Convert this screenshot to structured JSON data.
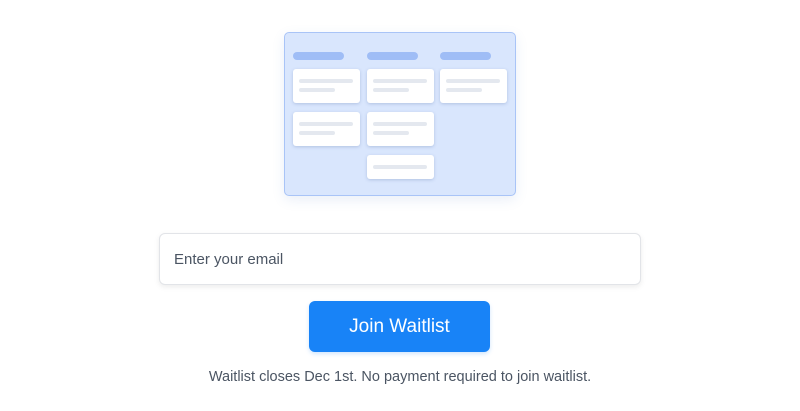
{
  "waitlist": {
    "email_placeholder": "Enter your email",
    "join_button_label": "Join Waitlist",
    "note": "Waitlist closes Dec 1st. No payment required to join waitlist."
  },
  "theme": {
    "accent": "#1883f7",
    "illustration_bg": "#d9e6fd",
    "illustration_header": "#9fbdf6"
  }
}
